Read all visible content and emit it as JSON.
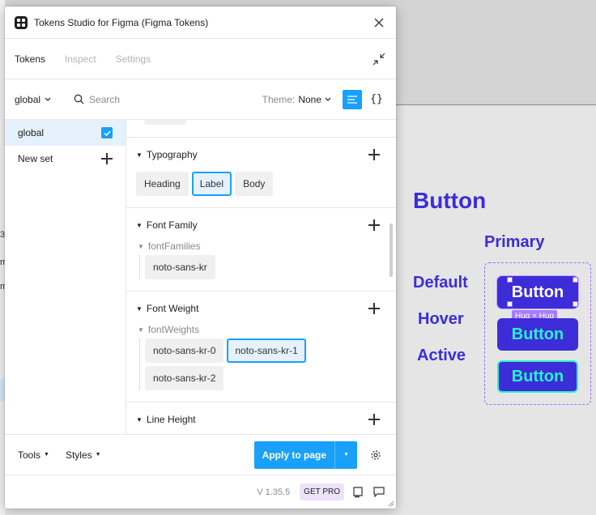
{
  "window": {
    "title": "Tokens Studio for Figma (Figma Tokens)"
  },
  "tabs": [
    "Tokens",
    "Inspect",
    "Settings"
  ],
  "toolbar": {
    "set_selector": "global",
    "search_placeholder": "Search",
    "theme_label": "Theme:",
    "theme_value": "None"
  },
  "sets": {
    "items": [
      {
        "label": "global",
        "checked": true
      },
      {
        "label": "New set"
      }
    ]
  },
  "sections": {
    "typography": {
      "title": "Typography",
      "tokens": [
        "Heading",
        "Label",
        "Body"
      ],
      "selected": "Label"
    },
    "font_family": {
      "title": "Font Family",
      "group": "fontFamilies",
      "tokens": [
        "noto-sans-kr"
      ]
    },
    "font_weight": {
      "title": "Font Weight",
      "group": "fontWeights",
      "tokens": [
        "noto-sans-kr-0",
        "noto-sans-kr-1",
        "noto-sans-kr-2"
      ],
      "selected": "noto-sans-kr-1"
    },
    "line_height": {
      "title": "Line Height"
    }
  },
  "footer": {
    "tools_label": "Tools",
    "styles_label": "Styles",
    "apply_label": "Apply to page"
  },
  "statusbar": {
    "version": "V 1.35.5",
    "get_pro": "GET PRO"
  },
  "design": {
    "title": "Button",
    "column": "Primary",
    "rows": [
      "Default",
      "Hover",
      "Active"
    ],
    "button_label": "Button",
    "hug_badge": "Hug × Hug",
    "colors": {
      "brand": "#3c2dd8",
      "text_accent": "#2af0d0",
      "selection": "#9c6cff"
    }
  },
  "canvas_truncated_text": [
    "3",
    "m",
    "m"
  ],
  "accent_color": "#18a0fb"
}
